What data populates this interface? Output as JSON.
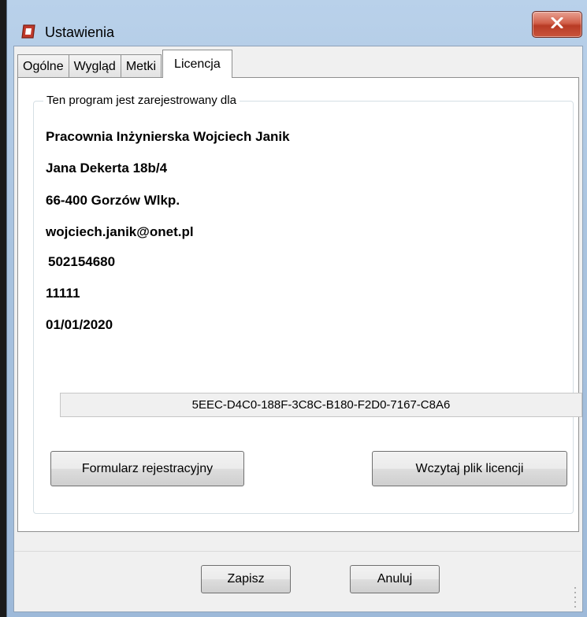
{
  "window": {
    "title": "Ustawienia"
  },
  "tabs": [
    {
      "label": "Ogólne"
    },
    {
      "label": "Wygląd"
    },
    {
      "label": "Metki"
    },
    {
      "label": "Licencja"
    }
  ],
  "license": {
    "group_title": "Ten program jest zarejestrowany dla",
    "lines": [
      "Pracownia Inżynierska Wojciech Janik",
      "Jana Dekerta 18b/4",
      "66-400 Gorzów Wlkp.",
      "wojciech.janik@onet.pl",
      "502154680",
      "11111",
      "01/01/2020"
    ],
    "serial": "5EEC-D4C0-188F-3C8C-B180-F2D0-7167-C8A6",
    "registration_form_label": "Formularz rejestracyjny",
    "load_license_label": "Wczytaj plik licencji"
  },
  "footer": {
    "save_label": "Zapisz",
    "cancel_label": "Anuluj"
  },
  "colors": {
    "window_frame": "#a9c3df",
    "close_button": "#c9543b",
    "app_icon": "#c0392b"
  }
}
